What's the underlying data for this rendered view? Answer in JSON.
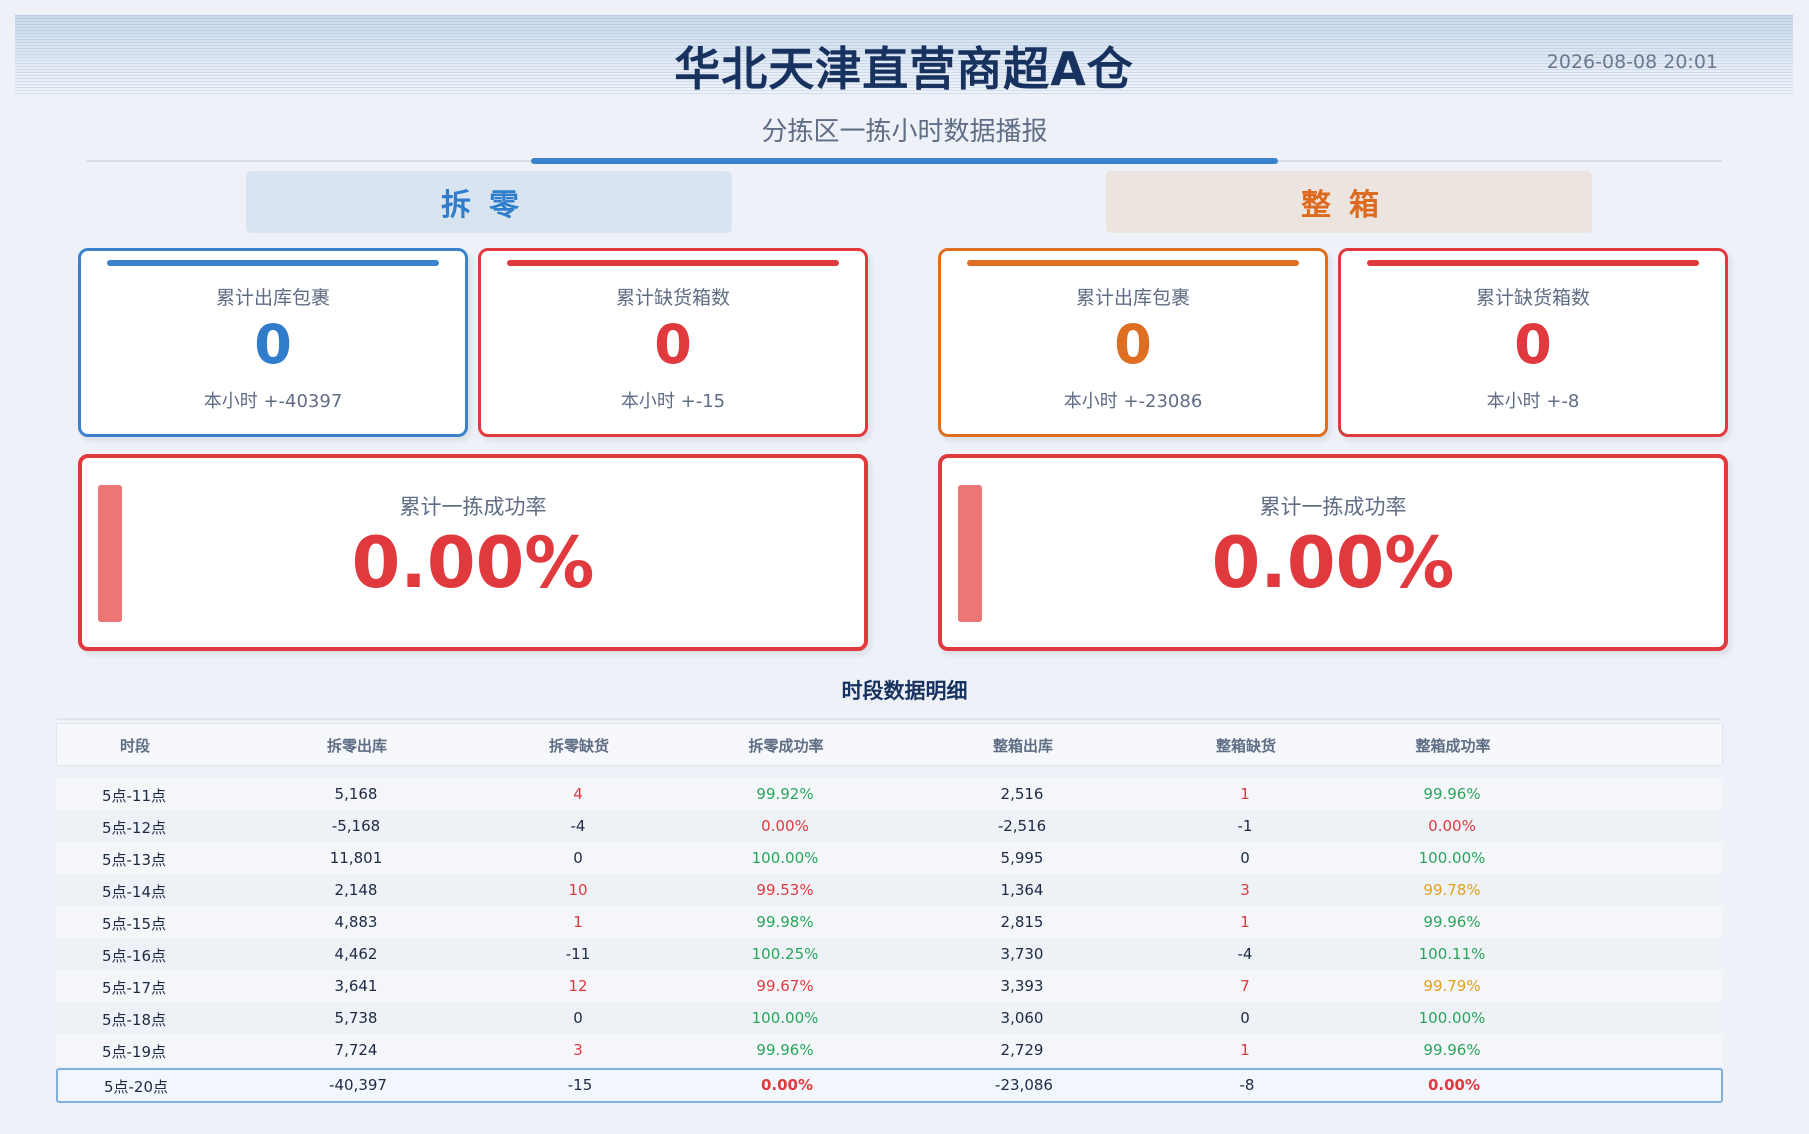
{
  "header": {
    "title": "华北天津直营商超A仓",
    "time": "2026-08-08 20:01",
    "subtitle": "分拣区一拣小时数据播报"
  },
  "colors": {
    "blue": "#3a82cc",
    "red": "#e0393e",
    "orange": "#de6e22",
    "green": "#2aa55c",
    "amber": "#e0a21a"
  },
  "chailing": {
    "label": "拆零",
    "outbound": {
      "label": "累计出库包裹",
      "value": "0",
      "delta": "本小时 +-40397"
    },
    "shortage": {
      "label": "累计缺货箱数",
      "value": "0",
      "delta": "本小时 +-15"
    },
    "rate": {
      "label": "累计一拣成功率",
      "value": "0.00%"
    }
  },
  "zhengxiang": {
    "label": "整箱",
    "outbound": {
      "label": "累计出库包裹",
      "value": "0",
      "delta": "本小时 +-23086"
    },
    "shortage": {
      "label": "累计缺货箱数",
      "value": "0",
      "delta": "本小时 +-8"
    },
    "rate": {
      "label": "累计一拣成功率",
      "value": "0.00%"
    }
  },
  "table": {
    "title": "时段数据明细",
    "columns": [
      "时段",
      "拆零出库",
      "拆零缺货",
      "拆零成功率",
      "整箱出库",
      "整箱缺货",
      "整箱成功率"
    ],
    "rows": [
      [
        "5点-11点",
        "5,168",
        "4",
        "99.92%",
        "2,516",
        "1",
        "99.96%"
      ],
      [
        "5点-12点",
        "-5,168",
        "-4",
        "0.00%",
        "-2,516",
        "-1",
        "0.00%"
      ],
      [
        "5点-13点",
        "11,801",
        "0",
        "100.00%",
        "5,995",
        "0",
        "100.00%"
      ],
      [
        "5点-14点",
        "2,148",
        "10",
        "99.53%",
        "1,364",
        "3",
        "99.78%"
      ],
      [
        "5点-15点",
        "4,883",
        "1",
        "99.98%",
        "2,815",
        "1",
        "99.96%"
      ],
      [
        "5点-16点",
        "4,462",
        "-11",
        "100.25%",
        "3,730",
        "-4",
        "100.11%"
      ],
      [
        "5点-17点",
        "3,641",
        "12",
        "99.67%",
        "3,393",
        "7",
        "99.79%"
      ],
      [
        "5点-18点",
        "5,738",
        "0",
        "100.00%",
        "3,060",
        "0",
        "100.00%"
      ],
      [
        "5点-19点",
        "7,724",
        "3",
        "99.96%",
        "2,729",
        "1",
        "99.96%"
      ],
      [
        "5点-20点",
        "-40,397",
        "-15",
        "0.00%",
        "-23,086",
        "-8",
        "0.00%"
      ]
    ]
  }
}
